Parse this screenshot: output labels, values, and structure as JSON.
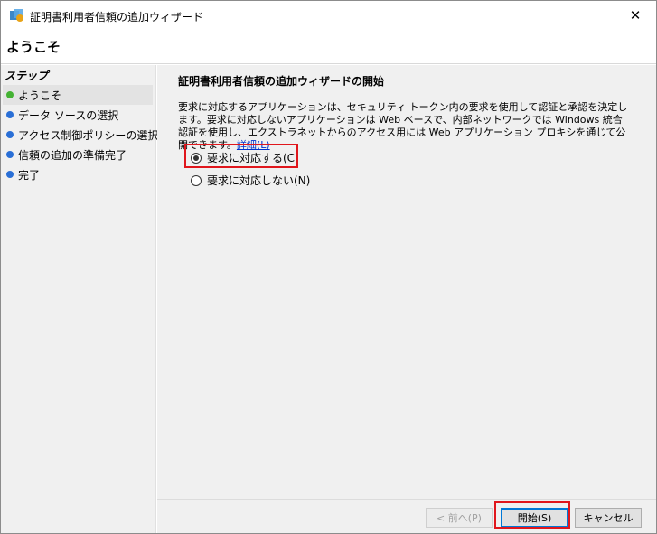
{
  "window": {
    "title": "証明書利用者信頼の追加ウィザード",
    "close_glyph": "✕"
  },
  "header": {
    "title": "ようこそ"
  },
  "sidebar": {
    "heading": "ステップ",
    "steps": [
      {
        "label": "ようこそ",
        "status_color": "#44b233"
      },
      {
        "label": "データ ソースの選択",
        "status_color": "#2a6fd6"
      },
      {
        "label": "アクセス制御ポリシーの選択",
        "status_color": "#2a6fd6"
      },
      {
        "label": "信頼の追加の準備完了",
        "status_color": "#2a6fd6"
      },
      {
        "label": "完了",
        "status_color": "#2a6fd6"
      }
    ]
  },
  "main": {
    "title": "証明書利用者信頼の追加ウィザードの開始",
    "description": "要求に対応するアプリケーションは、セキュリティ トークン内の要求を使用して認証と承認を決定します。要求に対応しないアプリケーションは Web ベースで、内部ネットワークでは Windows 統合認証を使用し、エクストラネットからのアクセス用には Web アプリケーション プロキシを通じて公開できます。",
    "details_link": "詳細(L)",
    "options": [
      {
        "label": "要求に対応する(C)",
        "checked": true
      },
      {
        "label": "要求に対応しない(N)",
        "checked": false
      }
    ]
  },
  "footer": {
    "back_label": "< 前へ(P)",
    "start_label": "開始(S)",
    "cancel_label": "キャンセル"
  },
  "colors": {
    "highlight_box": "#e0161c",
    "link": "#0033cc",
    "default_button_border": "#0078d7"
  }
}
